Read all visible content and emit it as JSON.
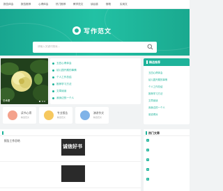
{
  "nav": [
    "报告体会",
    "报告推荐",
    "心得体会",
    "热门推荐",
    "教学范文",
    "读后感",
    "随笔",
    "实用文"
  ],
  "search": {
    "placeholder": "请输入关键词搜索..."
  },
  "brand": {
    "name": "写作范文"
  },
  "carousel": {
    "caption": "艺术课"
  },
  "middle_list": [
    "五四心得体会",
    "幼儿园开展的事情",
    "个人工作总结",
    "推荐学习方法",
    "文章阅读",
    "我身边的一个人"
  ],
  "tiles": [
    {
      "label": "读书心得",
      "sub": "精选范文",
      "color": "#f4a28c"
    },
    {
      "label": "专业报告",
      "sub": "精选范文",
      "color": "#f6c85f"
    },
    {
      "label": "演讲作文",
      "sub": "精选范文",
      "color": "#7fb3e8"
    }
  ],
  "side_top": {
    "title": "精选推荐",
    "items": [
      "五四心得体会",
      "幼儿园开展的事情",
      "个人工作总结",
      "推荐学习方法",
      "文章阅读",
      "我身边的一个人",
      "谁说得对"
    ]
  },
  "sections": {
    "latest": "",
    "hot": "热门文章"
  },
  "articles": [
    {
      "title": "报告工作总结",
      "meta": "",
      "thumb": "诚信好书",
      "desc": "",
      "date": ""
    },
    {
      "title": "",
      "meta": "",
      "thumb": "",
      "desc": "",
      "date": ""
    }
  ],
  "side_bottom": [
    "",
    "",
    "",
    "",
    ""
  ],
  "colors": {
    "accent": "#1eb39a",
    "hero_from": "#18a58f",
    "hero_to": "#22c1a4"
  }
}
